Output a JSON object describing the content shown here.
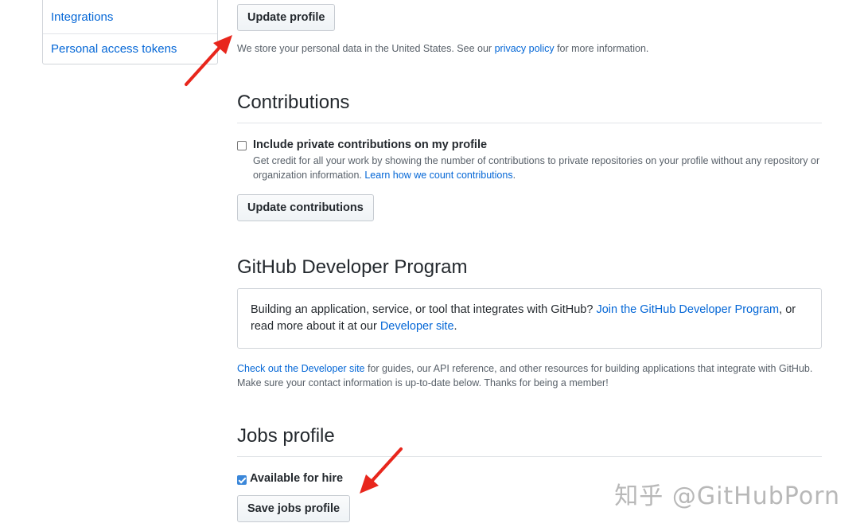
{
  "sidebar": {
    "items": [
      {
        "label": "Integrations"
      },
      {
        "label": "Personal access tokens"
      }
    ]
  },
  "profile": {
    "update_button": "Update profile",
    "privacy_note_before": "We store your personal data in the United States. See our ",
    "privacy_link": "privacy policy",
    "privacy_note_after": " for more information."
  },
  "contributions": {
    "heading": "Contributions",
    "checkbox_label": "Include private contributions on my profile",
    "checkbox_checked": false,
    "description_line1": "Get credit for all your work by showing the number of contributions to private repositories on your profile without any repository or",
    "description_line2_before": "organization information. ",
    "description_link": "Learn how we count contributions",
    "description_line2_after": ".",
    "update_button": "Update contributions"
  },
  "developer_program": {
    "heading": "GitHub Developer Program",
    "box_text_1": "Building an application, service, or tool that integrates with GitHub? ",
    "box_link_1": "Join the GitHub Developer Program",
    "box_text_2": ", or",
    "box_text_3": "read more about it at our ",
    "box_link_2": "Developer site",
    "box_text_4": ".",
    "note_link": "Check out the Developer site",
    "note_text_1": " for guides, our API reference, and other resources for building applications that integrate with GitHub.",
    "note_text_2": "Make sure your contact information is up-to-date below. Thanks for being a member!"
  },
  "jobs_profile": {
    "heading": "Jobs profile",
    "checkbox_label": "Available for hire",
    "checkbox_checked": true,
    "save_button": "Save jobs profile"
  },
  "watermark": "知乎 @GitHubPorn",
  "colors": {
    "link": "#0366d6",
    "arrow": "#e8261c",
    "checkbox_checked": "#3b87d9"
  }
}
